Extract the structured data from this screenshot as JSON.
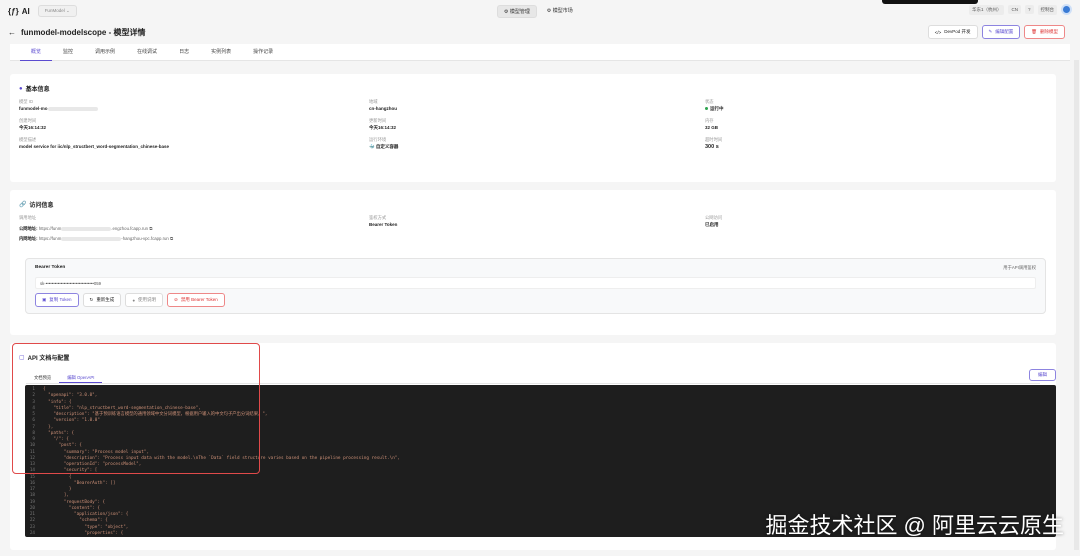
{
  "topbar": {
    "logo": "AI",
    "workspace": "FunModel",
    "nav": [
      "模型管理",
      "模型市场"
    ],
    "region": "华东1（杭州）",
    "lang": "CN",
    "help": "?",
    "console": "控制台"
  },
  "header": {
    "title": "funmodel-modelscope - 模型详情",
    "buttons": {
      "devpod": "DevPod 开发",
      "edit": "编辑配置",
      "delete": "删除模型"
    }
  },
  "tabs": [
    "概览",
    "监控",
    "调用示例",
    "在线调试",
    "日志",
    "实例列表",
    "操作记录"
  ],
  "basic": {
    "title": "基本信息",
    "fields": [
      {
        "label": "模型 ID",
        "value": "funmodel-mo"
      },
      {
        "label": "地域",
        "value": "cn-hangzhou"
      },
      {
        "label": "状态",
        "value": "运行中"
      },
      {
        "label": "创建时间",
        "value": "今天16:14:32"
      },
      {
        "label": "更新时间",
        "value": "今天16:14:32"
      },
      {
        "label": "内存",
        "value": "32 GB"
      },
      {
        "label": "模型描述",
        "value": "model service for iic/nlp_structbert_word-segmentation_chinese-base"
      },
      {
        "label": "运行环境",
        "value": "自定义容器"
      },
      {
        "label": "超时时间",
        "value": "300 s"
      }
    ]
  },
  "access": {
    "title": "访问信息",
    "addr_label": "调用地址",
    "public_label": "公网地址:",
    "public_url_start": "https://funm",
    "public_url_end": ".engzhou.fcapp.run",
    "private_label": "内网地址:",
    "private_url_start": "https://funm",
    "private_url_end": "-hangzhou-vpc.fcapp.run",
    "auth_label": "鉴权方式",
    "auth_value": "Bearer Token",
    "public_access_label": "公网访问",
    "public_access_value": "已启用",
    "token": {
      "title": "Bearer Token",
      "hint": "用于API调用鉴权",
      "value": "sk-••••••••••••••••••••••••••••••••059",
      "buttons": [
        "复制 Token",
        "重新生成",
        "使用说明",
        "禁用 Bearer Token"
      ]
    }
  },
  "api": {
    "title": "API 文档与配置",
    "subtabs": [
      "文档预览",
      "编辑 OpenAPI"
    ],
    "edit": "编辑",
    "code": [
      "{",
      "  \"openapi\": \"3.0.0\",",
      "  \"info\": {",
      "    \"title\": \"nlp_structbert_word-segmentation_chinese-base\",",
      "    \"description\": \"基于预训练语言模型的通用领域中文分词模型，根据用户输入的中文句子产出分词结果。\",",
      "    \"version\": \"1.0.0\"",
      "  },",
      "  \"paths\": {",
      "    \"/\": {",
      "      \"post\": {",
      "        \"summary\": \"Process model input\",",
      "        \"description\": \"Process input data with the model.\\nThe `Data` field structure varies based on the pipeline processing result.\\n\",",
      "        \"operationId\": \"processModel\",",
      "        \"security\": [",
      "          {",
      "            \"BearerAuth\": []",
      "          }",
      "        ],",
      "        \"requestBody\": {",
      "          \"content\": {",
      "            \"application/json\": {",
      "              \"schema\": {",
      "                \"type\": \"object\",",
      "                \"properties\": {"
    ]
  },
  "watermark": "掘金技术社区 @ 阿里云云原生"
}
